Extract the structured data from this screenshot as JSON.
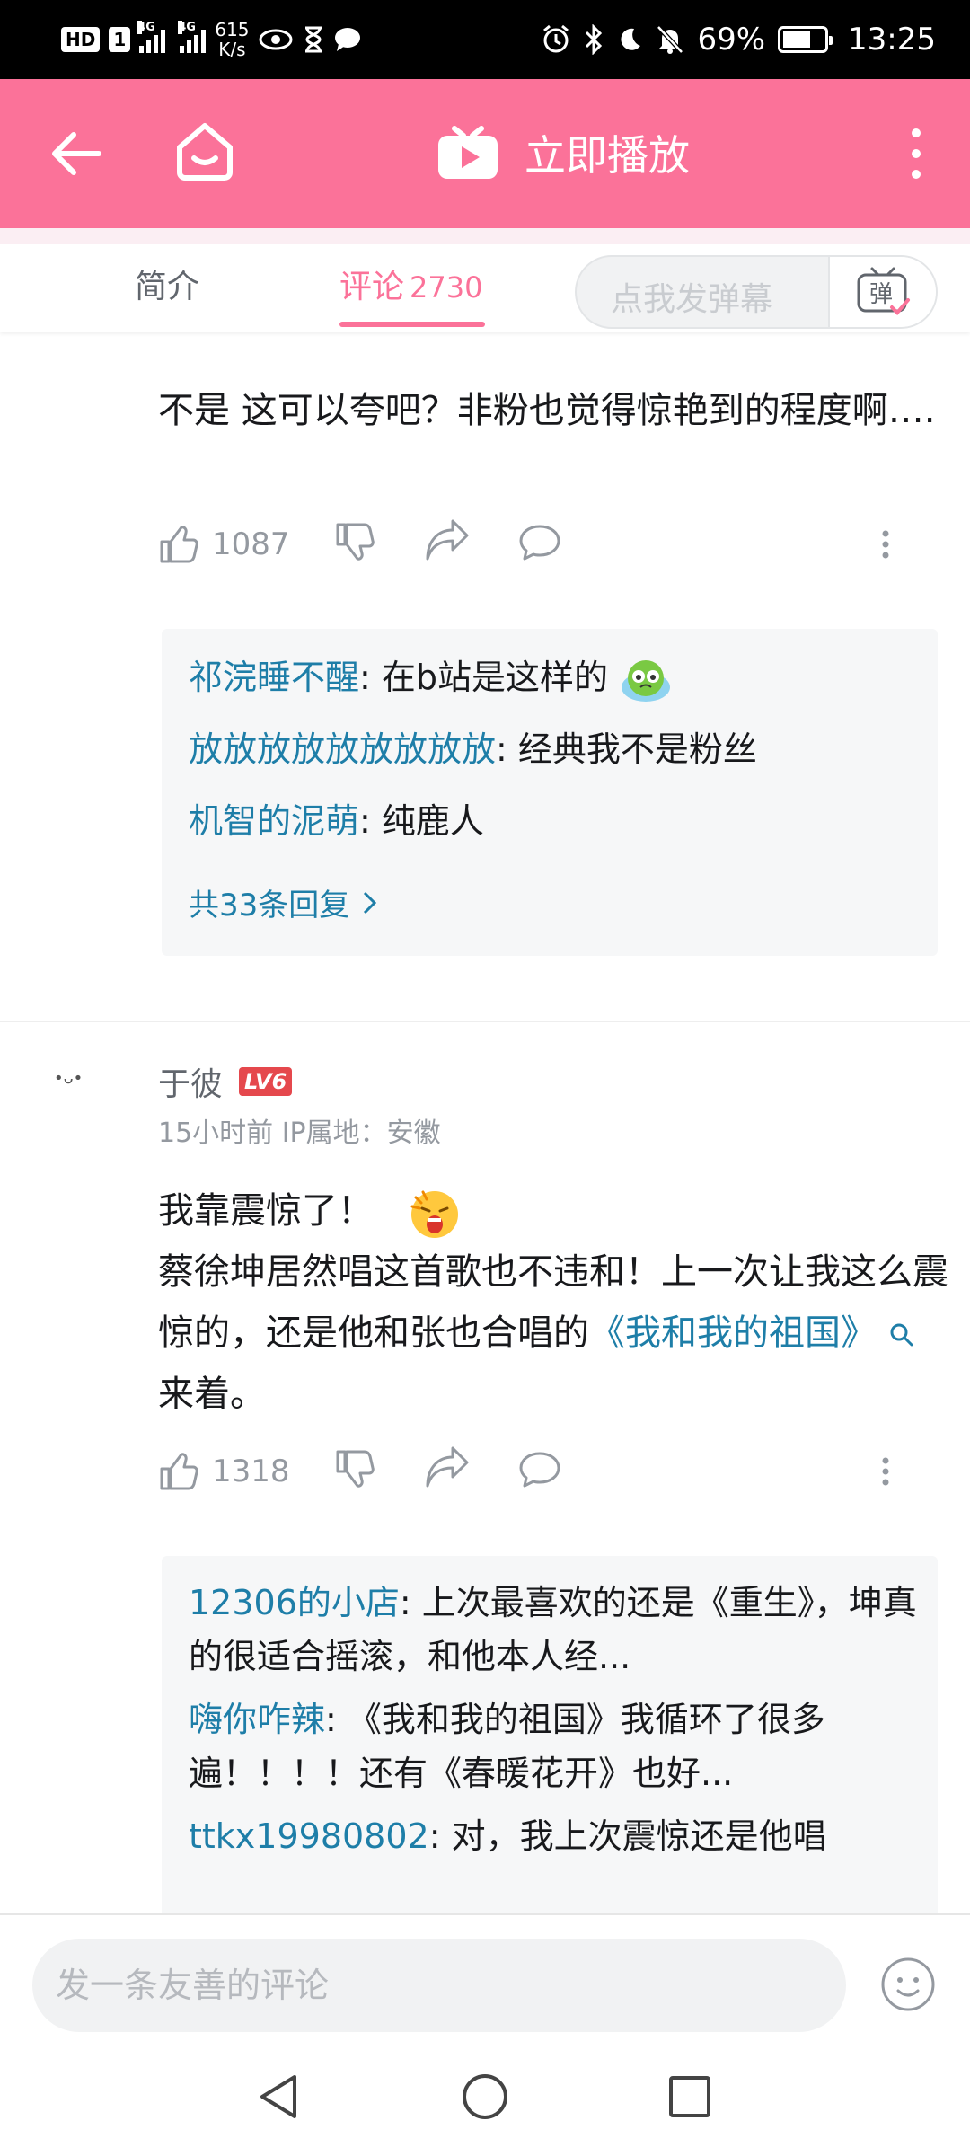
{
  "status_bar": {
    "hd": "HD",
    "sim": "1",
    "net1": "4G",
    "net2": "4G",
    "speed_value": "615",
    "speed_unit": "K/s",
    "battery": "69%",
    "time": "13:25",
    "battery_level": 0.69
  },
  "header": {
    "title": "立即播放",
    "icons": [
      "back-arrow-icon",
      "home-icon",
      "tv-play-icon",
      "more-vertical-icon"
    ]
  },
  "tabs": {
    "intro_label": "简介",
    "comments_label": "评论",
    "comments_count": "2730",
    "danmaku_placeholder": "点我发弹幕",
    "danmaku_toggle_label": "弹"
  },
  "comments": [
    {
      "text": "不是 这可以夸吧？非粉也觉得惊艳到的程度啊….",
      "likes": "1087",
      "replies": [
        {
          "name": "祁浣睡不醒",
          "text": ": 在b站是这样的"
        },
        {
          "name": "放放放放放放放放放",
          "text": ": 经典我不是粉丝"
        },
        {
          "name": "机智的泥萌",
          "text": ": 纯鹿人"
        }
      ],
      "more_replies": "共33条回复"
    },
    {
      "avatar_text": "•ᴗ•",
      "username": "于彼",
      "level": "LV6",
      "meta": "15小时前  IP属地：安徽",
      "line1": "我靠震惊了！",
      "text_a": "蔡徐坤居然唱这首歌也不违和！上一次让我这么震惊的，还是他和张也合唱的",
      "link": "《我和我的祖国》",
      "text_b": "来着。",
      "likes": "1318",
      "replies": [
        {
          "name": "12306的小店",
          "text": ": 上次最喜欢的还是《重生》，坤真的很适合摇滚，和他本人经..."
        },
        {
          "name": "嗨你咋辣",
          "text": ": 《我和我的祖国》我循环了很多遍！！！！还有《春暖花开》也好..."
        },
        {
          "name": "ttkx19980802",
          "text": ": 对，我上次震惊还是他唱"
        }
      ]
    }
  ],
  "bottom": {
    "input_placeholder": "发一条友善的评论"
  },
  "colors": {
    "brand_pink": "#fb7299",
    "link_blue": "#1e7ea8",
    "level_red": "#e5484d"
  }
}
